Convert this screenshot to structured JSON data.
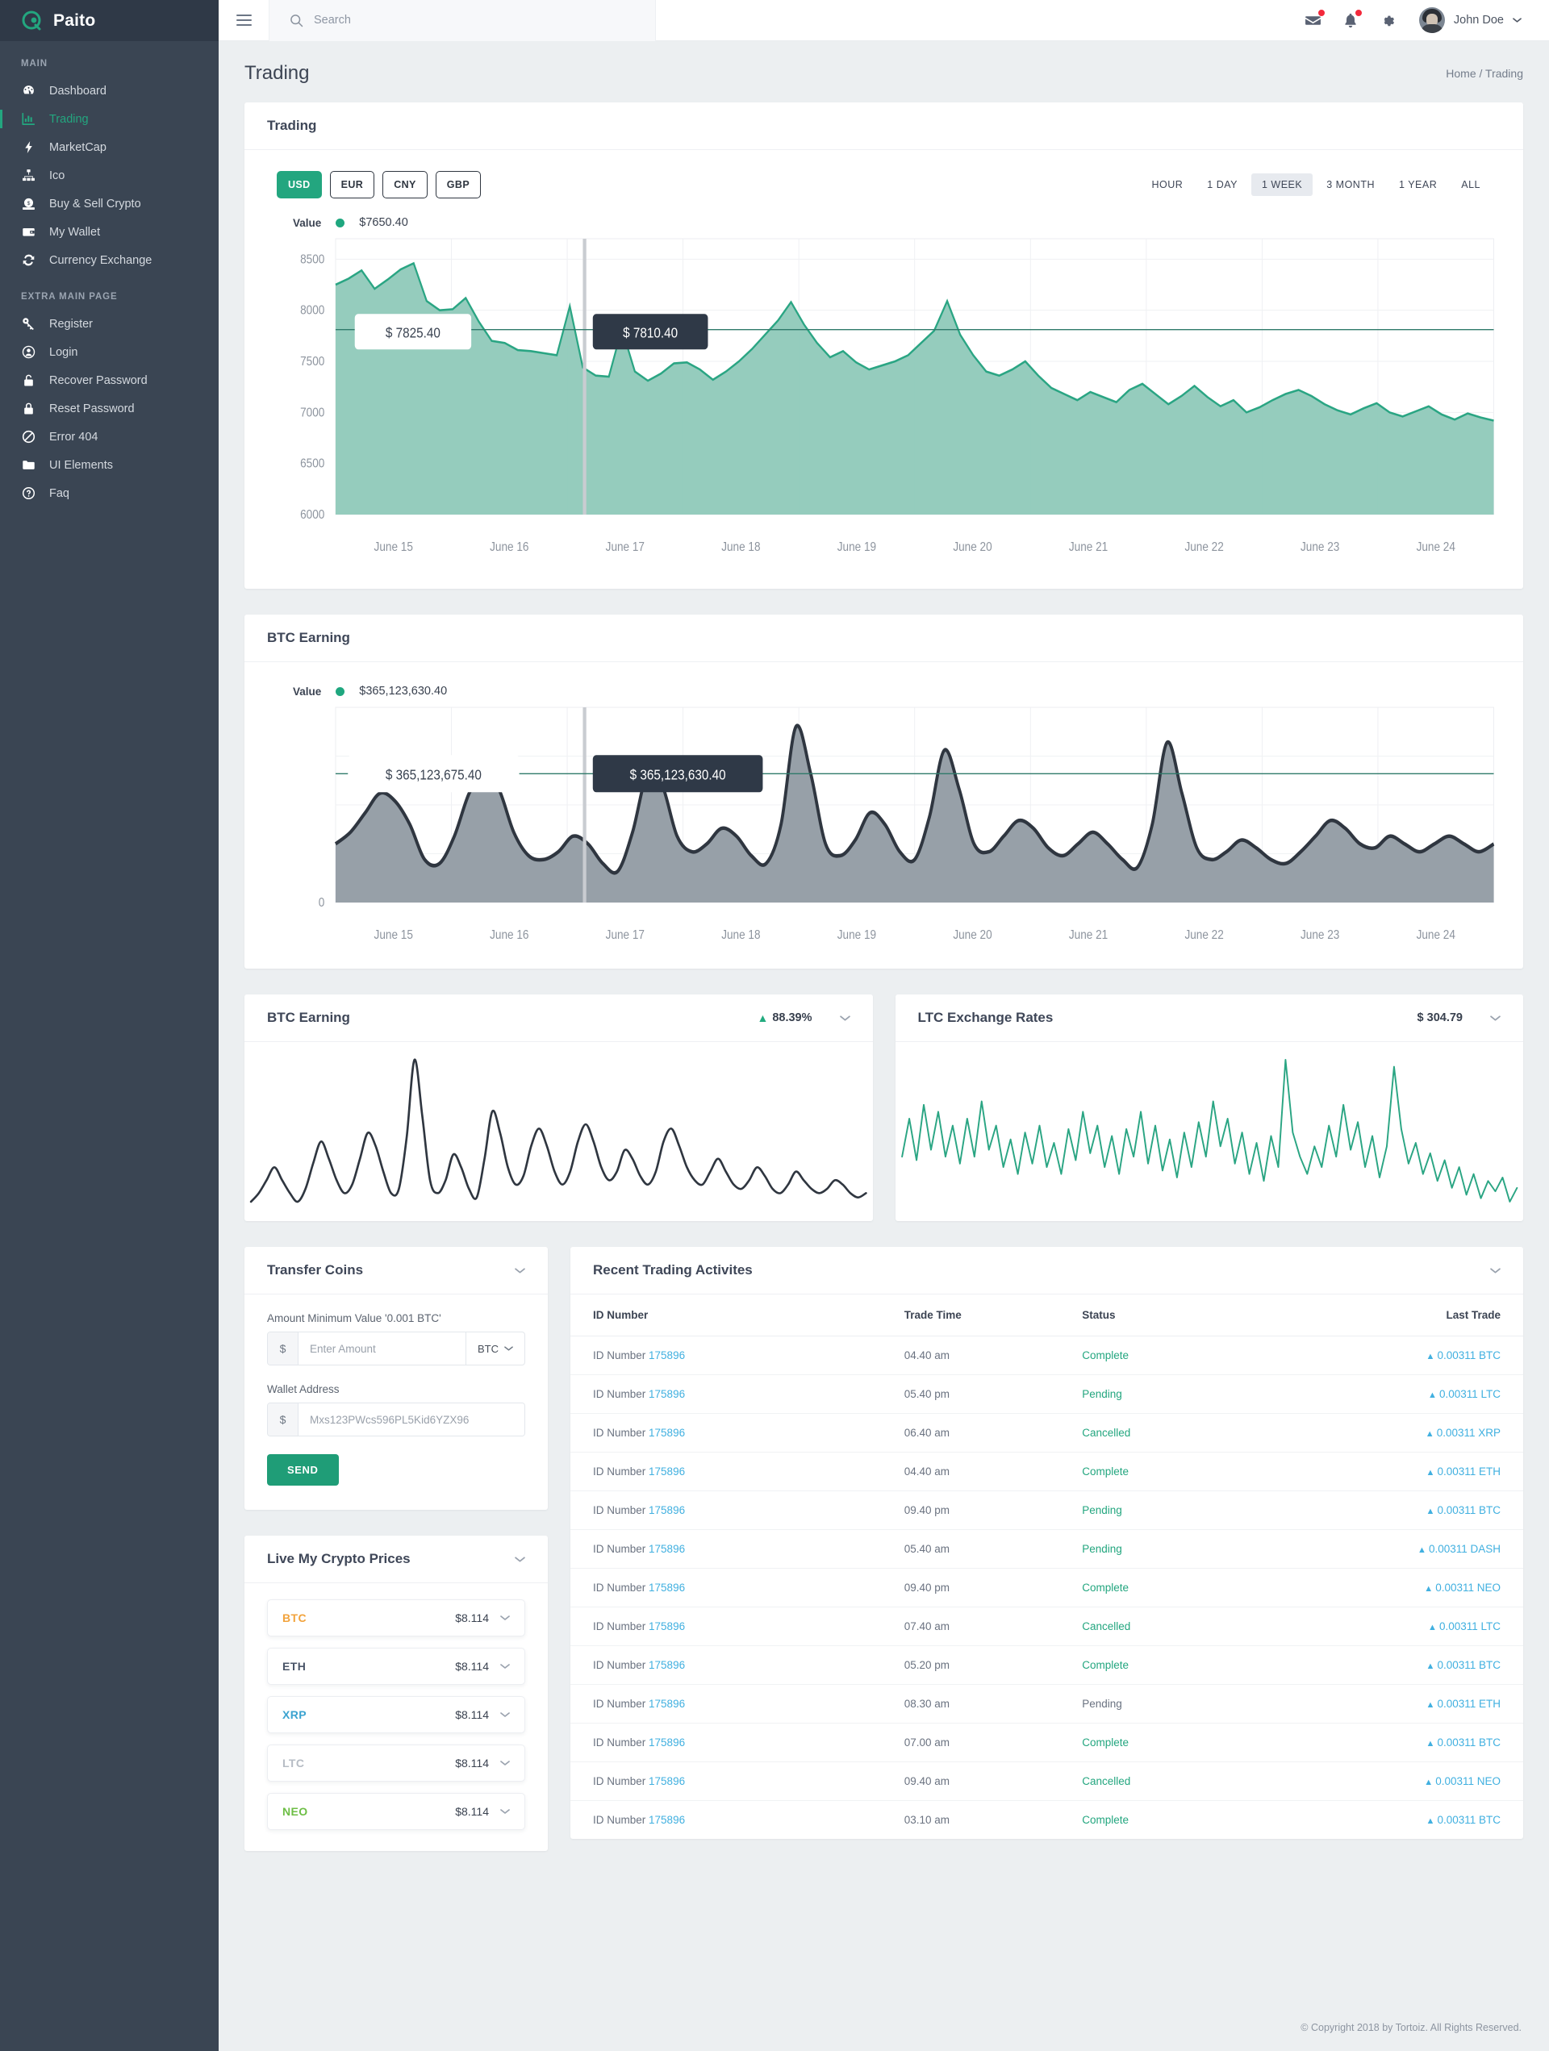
{
  "brand": {
    "name": "Paito",
    "logo_icon": "paito-logo-icon"
  },
  "sidebar": {
    "sections": [
      {
        "label": "MAIN",
        "items": [
          {
            "label": "Dashboard",
            "icon": "speedometer-icon",
            "active": false
          },
          {
            "label": "Trading",
            "icon": "line-chart-icon",
            "active": true
          },
          {
            "label": "MarketCap",
            "icon": "bolt-icon",
            "active": false
          },
          {
            "label": "Ico",
            "icon": "sitemap-icon",
            "active": false
          },
          {
            "label": "Buy & Sell Crypto",
            "icon": "money-bag-icon",
            "active": false
          },
          {
            "label": "My Wallet",
            "icon": "wallet-icon",
            "active": false
          },
          {
            "label": "Currency Exchange",
            "icon": "refresh-icon",
            "active": false
          }
        ]
      },
      {
        "label": "EXTRA MAIN PAGE",
        "items": [
          {
            "label": "Register",
            "icon": "key-icon",
            "active": false
          },
          {
            "label": "Login",
            "icon": "user-circle-icon",
            "active": false
          },
          {
            "label": "Recover Password",
            "icon": "lock-open-icon",
            "active": false
          },
          {
            "label": "Reset Password",
            "icon": "lock-icon",
            "active": false
          },
          {
            "label": "Error 404",
            "icon": "ban-icon",
            "active": false
          },
          {
            "label": "UI Elements",
            "icon": "folder-icon",
            "active": false
          },
          {
            "label": "Faq",
            "icon": "question-circle-icon",
            "active": false
          }
        ]
      }
    ]
  },
  "topbar": {
    "menu_icon": "hamburger-icon",
    "search": {
      "placeholder": "Search",
      "value": "",
      "icon": "search-icon"
    },
    "icons": [
      {
        "name": "mail-icon",
        "badge": true
      },
      {
        "name": "bell-icon",
        "badge": true
      },
      {
        "name": "gear-icon",
        "badge": false
      }
    ],
    "user": {
      "name": "John Doe",
      "avatar": "user-avatar",
      "chevron": "chevron-down-icon"
    }
  },
  "page": {
    "title": "Trading",
    "breadcrumb": "Home / Trading"
  },
  "trading_card": {
    "title": "Trading",
    "currencies": [
      {
        "label": "USD",
        "active": true
      },
      {
        "label": "EUR",
        "active": false
      },
      {
        "label": "CNY",
        "active": false
      },
      {
        "label": "GBP",
        "active": false
      }
    ],
    "ranges": [
      {
        "label": "HOUR",
        "active": false
      },
      {
        "label": "1 DAY",
        "active": false
      },
      {
        "label": "1 WEEK",
        "active": true
      },
      {
        "label": "3 MONTH",
        "active": false
      },
      {
        "label": "1 YEAR",
        "active": false
      },
      {
        "label": "ALL",
        "active": false
      }
    ],
    "value_label": "Value",
    "value_amount": "$7650.40",
    "tooltip_light": "$ 7825.40",
    "tooltip_dark": "$ 7810.40"
  },
  "btc_card": {
    "title": "BTC Earning",
    "value_label": "Value",
    "value_amount": "$365,123,630.40",
    "tooltip_light": "$ 365,123,675.40",
    "tooltip_dark": "$ 365,123,630.40"
  },
  "mini_cards": [
    {
      "title": "BTC Earning",
      "metric": "88.39%",
      "metric_arrow": "▲",
      "has_arrow": true,
      "chevron": "chevron-down-icon",
      "color": "#2f3640"
    },
    {
      "title": "LTC Exchange Rates",
      "metric": "$ 304.79",
      "has_arrow": false,
      "chevron": "chevron-down-icon",
      "color": "#2aa582"
    }
  ],
  "transfer": {
    "title": "Transfer Coins",
    "chevron": "chevron-down-icon",
    "amount_label": "Amount Minimum Value '0.001 BTC'",
    "amount_addon": "$",
    "amount_placeholder": "Enter Amount",
    "amount_value": "",
    "coin_select": "BTC",
    "wallet_label": "Wallet Address",
    "wallet_addon": "$",
    "wallet_placeholder": "Mxs123PWcs596PL5Kid6YZX96",
    "wallet_value": "",
    "send_label": "SEND"
  },
  "live_prices": {
    "title": "Live My Crypto Prices",
    "chevron": "chevron-down-icon",
    "coins": [
      {
        "symbol": "BTC",
        "price": "$8.114",
        "color": "#f2a33c"
      },
      {
        "symbol": "ETH",
        "price": "$8.114",
        "color": "#4a5568"
      },
      {
        "symbol": "XRP",
        "price": "$8.114",
        "color": "#3ba3d0"
      },
      {
        "symbol": "LTC",
        "price": "$8.114",
        "color": "#b6bcc4"
      },
      {
        "symbol": "NEO",
        "price": "$8.114",
        "color": "#6dbe45"
      }
    ]
  },
  "activities": {
    "title": "Recent Trading Activites",
    "chevron": "chevron-down-icon",
    "columns": [
      "ID Number",
      "Trade Time",
      "Status",
      "Last Trade"
    ],
    "rows": [
      {
        "id_prefix": "ID Number",
        "id": "175896",
        "time": "04.40 am",
        "status": "Complete",
        "status_style": "green",
        "trade": "0.00311 BTC"
      },
      {
        "id_prefix": "ID Number",
        "id": "175896",
        "time": "05.40 pm",
        "status": "Pending",
        "status_style": "green",
        "trade": "0.00311 LTC"
      },
      {
        "id_prefix": "ID Number",
        "id": "175896",
        "time": "06.40 am",
        "status": "Cancelled",
        "status_style": "green",
        "trade": "0.00311 XRP"
      },
      {
        "id_prefix": "ID Number",
        "id": "175896",
        "time": "04.40 am",
        "status": "Complete",
        "status_style": "green",
        "trade": "0.00311 ETH"
      },
      {
        "id_prefix": "ID Number",
        "id": "175896",
        "time": "09.40 pm",
        "status": "Pending",
        "status_style": "green",
        "trade": "0.00311 BTC"
      },
      {
        "id_prefix": "ID Number",
        "id": "175896",
        "time": "05.40 am",
        "status": "Pending",
        "status_style": "green",
        "trade": "0.00311 DASH"
      },
      {
        "id_prefix": "ID Number",
        "id": "175896",
        "time": "09.40 pm",
        "status": "Complete",
        "status_style": "green",
        "trade": "0.00311 NEO"
      },
      {
        "id_prefix": "ID Number",
        "id": "175896",
        "time": "07.40 am",
        "status": "Cancelled",
        "status_style": "green",
        "trade": "0.00311 LTC"
      },
      {
        "id_prefix": "ID Number",
        "id": "175896",
        "time": "05.20 pm",
        "status": "Complete",
        "status_style": "green",
        "trade": "0.00311 BTC"
      },
      {
        "id_prefix": "ID Number",
        "id": "175896",
        "time": "08.30 am",
        "status": "Pending",
        "status_style": "gray",
        "trade": "0.00311 ETH"
      },
      {
        "id_prefix": "ID Number",
        "id": "175896",
        "time": "07.00 am",
        "status": "Complete",
        "status_style": "green",
        "trade": "0.00311 BTC"
      },
      {
        "id_prefix": "ID Number",
        "id": "175896",
        "time": "09.40 am",
        "status": "Cancelled",
        "status_style": "green",
        "trade": "0.00311 NEO"
      },
      {
        "id_prefix": "ID Number",
        "id": "175896",
        "time": "03.10 am",
        "status": "Complete",
        "status_style": "green",
        "trade": "0.00311 BTC"
      }
    ]
  },
  "footer": {
    "text": "© Copyright 2018 by Tortoiz. All Rights Reserved."
  },
  "colors": {
    "accent": "#23a67f",
    "sidebar_bg": "#3a4553",
    "page_bg": "#eceff1",
    "link": "#41b0e0",
    "danger": "#f3293b"
  },
  "chart_data": [
    {
      "type": "area",
      "name": "trading-area-chart",
      "title": "Trading",
      "series_name": "Value",
      "line_color": "#2aa583",
      "fill_color": "#8fc9b9",
      "ylabel": "",
      "xlabel": "",
      "ylim": [
        6000,
        8700
      ],
      "yticks": [
        8500,
        8000,
        7500,
        7000,
        6500,
        6000
      ],
      "grid": true,
      "categories": [
        "June 15",
        "June 16",
        "June 17",
        "June 18",
        "June 19",
        "June 20",
        "June 21",
        "June 22",
        "June 23",
        "June 24"
      ],
      "marker_value": "$7650.40",
      "tooltips": [
        {
          "text": "$ 7825.40",
          "style": "light",
          "x_index": 1
        },
        {
          "text": "$ 7810.40",
          "style": "dark",
          "x_index": 12
        }
      ],
      "values": [
        8250,
        8310,
        8390,
        8210,
        8300,
        8400,
        8460,
        8090,
        8000,
        8010,
        8120,
        7890,
        7700,
        7680,
        7610,
        7600,
        7580,
        7560,
        8040,
        7440,
        7360,
        7350,
        7820,
        7400,
        7310,
        7380,
        7480,
        7490,
        7420,
        7320,
        7400,
        7500,
        7620,
        7760,
        7900,
        8080,
        7860,
        7680,
        7540,
        7600,
        7490,
        7420,
        7460,
        7500,
        7560,
        7680,
        7800,
        8090,
        7760,
        7560,
        7400,
        7360,
        7420,
        7500,
        7360,
        7240,
        7180,
        7120,
        7200,
        7150,
        7100,
        7220,
        7280,
        7180,
        7080,
        7160,
        7260,
        7150,
        7060,
        7120,
        7000,
        7050,
        7120,
        7180,
        7220,
        7160,
        7080,
        7020,
        6980,
        7040,
        7090,
        7000,
        6960,
        7010,
        7060,
        6980,
        6930,
        6990,
        6950,
        6920
      ]
    },
    {
      "type": "area",
      "name": "btc-earning-area-chart",
      "title": "BTC Earning",
      "series_name": "Value",
      "line_color": "#2f3640",
      "fill_color": "#97a0a8",
      "ylabel": "",
      "xlabel": "",
      "ylim": [
        0,
        100
      ],
      "yticks": [
        0
      ],
      "grid": true,
      "categories": [
        "June 15",
        "June 16",
        "June 17",
        "June 18",
        "June 19",
        "June 20",
        "June 21",
        "June 22",
        "June 23",
        "June 24"
      ],
      "marker_value": "$365,123,630.40",
      "tooltips": [
        {
          "text": "$ 365,123,675.40",
          "style": "light",
          "x_index": 1
        },
        {
          "text": "$ 365,123,630.40",
          "style": "dark",
          "x_index": 12
        }
      ],
      "values": [
        30,
        36,
        46,
        56,
        52,
        40,
        22,
        20,
        34,
        56,
        66,
        58,
        36,
        24,
        22,
        26,
        34,
        30,
        20,
        16,
        36,
        66,
        60,
        34,
        26,
        30,
        38,
        34,
        24,
        20,
        40,
        90,
        66,
        30,
        24,
        32,
        46,
        40,
        26,
        22,
        44,
        78,
        58,
        30,
        26,
        34,
        42,
        38,
        28,
        24,
        30,
        36,
        30,
        22,
        18,
        40,
        82,
        56,
        28,
        22,
        26,
        32,
        28,
        22,
        20,
        26,
        34,
        42,
        38,
        30,
        28,
        34,
        30,
        26,
        30,
        34,
        30,
        26,
        30
      ]
    },
    {
      "type": "line",
      "name": "btc-earning-mini-chart",
      "title": "BTC Earning",
      "metric": "88.39%",
      "line_color": "#2f3640",
      "grid": false,
      "values": [
        30,
        34,
        40,
        46,
        40,
        34,
        30,
        36,
        48,
        58,
        50,
        40,
        34,
        38,
        50,
        62,
        56,
        44,
        34,
        36,
        60,
        96,
        70,
        40,
        34,
        40,
        52,
        46,
        36,
        32,
        50,
        72,
        62,
        46,
        38,
        42,
        56,
        64,
        56,
        44,
        38,
        44,
        58,
        66,
        58,
        46,
        40,
        44,
        54,
        50,
        42,
        38,
        44,
        58,
        64,
        56,
        46,
        40,
        38,
        44,
        50,
        44,
        38,
        36,
        40,
        46,
        42,
        36,
        34,
        38,
        44,
        40,
        36,
        34,
        36,
        40,
        38,
        34,
        32,
        34
      ]
    },
    {
      "type": "line",
      "name": "ltc-exchange-rates-mini-chart",
      "title": "LTC Exchange Rates",
      "metric": "$ 304.79",
      "line_color": "#2aa583",
      "grid": false,
      "values": [
        40,
        62,
        38,
        70,
        44,
        66,
        40,
        58,
        36,
        62,
        40,
        72,
        44,
        58,
        34,
        50,
        30,
        54,
        36,
        58,
        34,
        48,
        30,
        56,
        38,
        66,
        42,
        58,
        34,
        52,
        30,
        56,
        40,
        66,
        36,
        58,
        32,
        50,
        28,
        54,
        34,
        60,
        40,
        72,
        46,
        62,
        36,
        54,
        30,
        48,
        26,
        52,
        34,
        96,
        54,
        40,
        30,
        46,
        34,
        58,
        40,
        70,
        44,
        60,
        34,
        52,
        28,
        46,
        92,
        56,
        36,
        48,
        30,
        42,
        26,
        38,
        22,
        34,
        18,
        30,
        16,
        26,
        20,
        28,
        14,
        22
      ]
    }
  ]
}
